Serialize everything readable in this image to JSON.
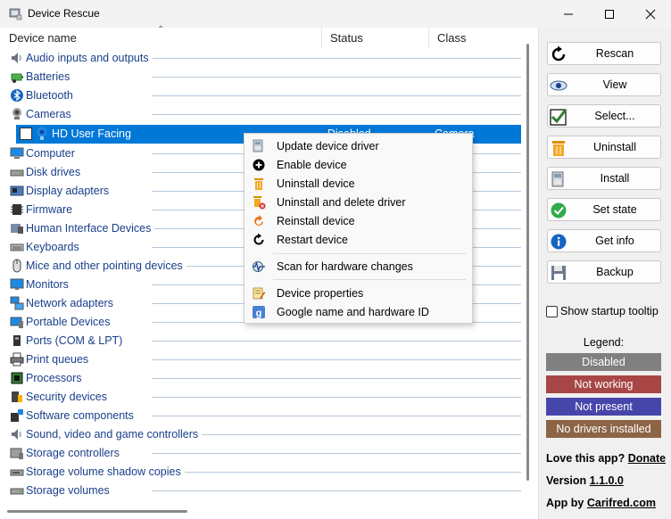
{
  "window": {
    "title": "Device Rescue",
    "icon": "device-rescue-app-icon",
    "controls": [
      "minimize",
      "maximize",
      "close"
    ]
  },
  "columns": {
    "device_name": "Device name",
    "status": "Status",
    "class": "Class"
  },
  "devices": [
    {
      "label": "Audio inputs and outputs",
      "icon": "speaker-icon"
    },
    {
      "label": "Batteries",
      "icon": "battery-icon"
    },
    {
      "label": "Bluetooth",
      "icon": "bluetooth-icon"
    },
    {
      "label": "Cameras",
      "icon": "camera-icon"
    },
    {
      "label": "Computer",
      "icon": "computer-icon"
    },
    {
      "label": "Disk drives",
      "icon": "disk-drive-icon"
    },
    {
      "label": "Display adapters",
      "icon": "display-adapter-icon"
    },
    {
      "label": "Firmware",
      "icon": "firmware-icon"
    },
    {
      "label": "Human Interface Devices",
      "icon": "hid-icon"
    },
    {
      "label": "Keyboards",
      "icon": "keyboard-icon"
    },
    {
      "label": "Mice and other pointing devices",
      "icon": "mouse-icon"
    },
    {
      "label": "Monitors",
      "icon": "monitor-icon"
    },
    {
      "label": "Network adapters",
      "icon": "network-adapter-icon"
    },
    {
      "label": "Portable Devices",
      "icon": "portable-device-icon"
    },
    {
      "label": "Ports (COM & LPT)",
      "icon": "port-icon"
    },
    {
      "label": "Print queues",
      "icon": "printer-icon"
    },
    {
      "label": "Processors",
      "icon": "processor-icon"
    },
    {
      "label": "Security devices",
      "icon": "security-device-icon"
    },
    {
      "label": "Software components",
      "icon": "software-component-icon"
    },
    {
      "label": "Sound, video and game controllers",
      "icon": "sound-icon"
    },
    {
      "label": "Storage controllers",
      "icon": "storage-controller-icon"
    },
    {
      "label": "Storage volume shadow copies",
      "icon": "storage-shadow-icon"
    },
    {
      "label": "Storage volumes",
      "icon": "storage-volume-icon"
    }
  ],
  "selected_device": {
    "label": "HD User Facing",
    "status": "Disabled",
    "class": "Camera",
    "icon": "webcam-icon"
  },
  "context_menu": {
    "items": [
      {
        "label": "Update device driver",
        "icon": "update-driver-icon"
      },
      {
        "label": "Enable device",
        "icon": "enable-icon"
      },
      {
        "label": "Uninstall device",
        "icon": "trash-icon"
      },
      {
        "label": "Uninstall and delete driver",
        "icon": "trash-delete-icon"
      },
      {
        "label": "Reinstall device",
        "icon": "reinstall-icon"
      },
      {
        "label": "Restart device",
        "icon": "restart-icon"
      },
      {
        "label": "Scan for hardware changes",
        "icon": "scan-icon"
      },
      {
        "label": "Device properties",
        "icon": "properties-icon"
      },
      {
        "label": "Google name and hardware ID",
        "icon": "google-icon"
      }
    ]
  },
  "sidebar": {
    "buttons": [
      {
        "label": "Rescan",
        "icon": "refresh-icon"
      },
      {
        "label": "View",
        "icon": "eye-icon"
      },
      {
        "label": "Select...",
        "icon": "checkmark-icon"
      },
      {
        "label": "Uninstall",
        "icon": "trash-icon"
      },
      {
        "label": "Install",
        "icon": "install-icon"
      },
      {
        "label": "Set state",
        "icon": "check-circle-icon"
      },
      {
        "label": "Get info",
        "icon": "info-icon"
      },
      {
        "label": "Backup",
        "icon": "floppy-icon"
      }
    ],
    "startup_tooltip": {
      "label": "Show startup tooltip",
      "checked": false
    },
    "legend_title": "Legend:",
    "legend": [
      {
        "label": "Disabled",
        "color": "#808080"
      },
      {
        "label": "Not working",
        "color": "#a84646"
      },
      {
        "label": "Not present",
        "color": "#4646aa"
      },
      {
        "label": "No drivers installed",
        "color": "#8c6446"
      }
    ],
    "footer": {
      "love_prefix": "Love this app?",
      "donate": "Donate",
      "version_prefix": "Version",
      "version": "1.1.0.0",
      "author_prefix": "App by",
      "author": "Carifred.com"
    }
  }
}
